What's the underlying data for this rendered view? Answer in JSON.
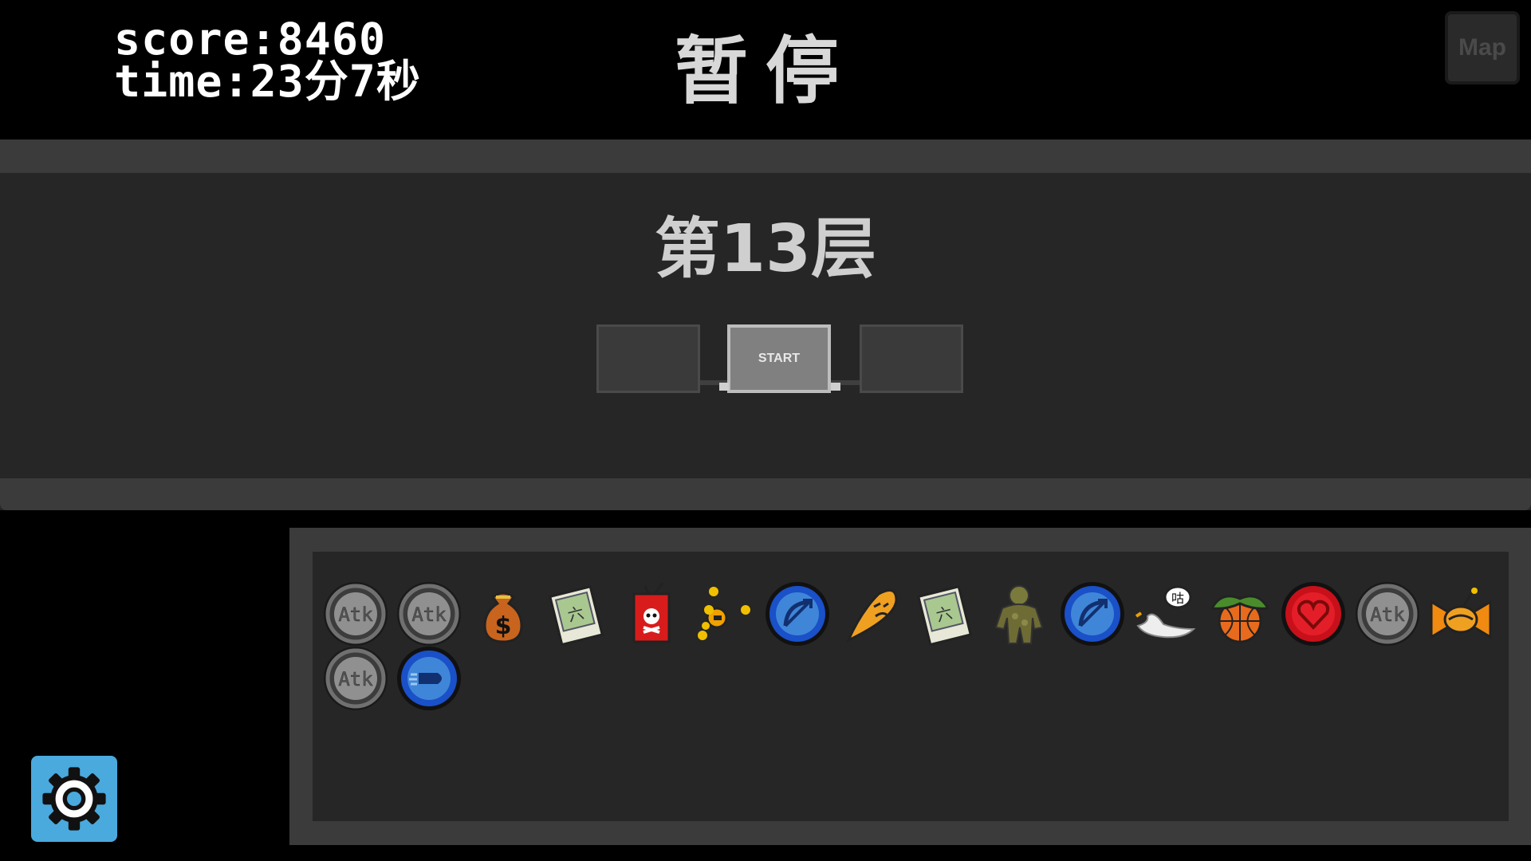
{
  "hud": {
    "score": "score:8460",
    "time": "time:23分7秒"
  },
  "pause_title": "暂停",
  "map_button_label": "Map",
  "floor": {
    "title": "第13层",
    "start_label": "START"
  },
  "inventory": {
    "items": [
      {
        "icon": "atk-coin-icon"
      },
      {
        "icon": "atk-coin-icon"
      },
      {
        "icon": "money-bag-icon"
      },
      {
        "icon": "spell-book-icon"
      },
      {
        "icon": "poison-box-icon"
      },
      {
        "icon": "orbit-dots-icon"
      },
      {
        "icon": "blue-bow-badge-icon"
      },
      {
        "icon": "angry-fireball-icon"
      },
      {
        "icon": "spell-book-icon"
      },
      {
        "icon": "moss-golem-icon"
      },
      {
        "icon": "blue-bow-badge-icon"
      },
      {
        "icon": "pigeon-speech-icon"
      },
      {
        "icon": "basketball-leaf-icon"
      },
      {
        "icon": "red-heart-badge-icon"
      },
      {
        "icon": "atk-coin-icon"
      },
      {
        "icon": "candy-bomb-icon"
      },
      {
        "icon": "atk-coin-icon"
      },
      {
        "icon": "blue-bullet-badge-icon"
      }
    ],
    "badge_text": "Atk"
  },
  "settings_icon": "gear-icon"
}
